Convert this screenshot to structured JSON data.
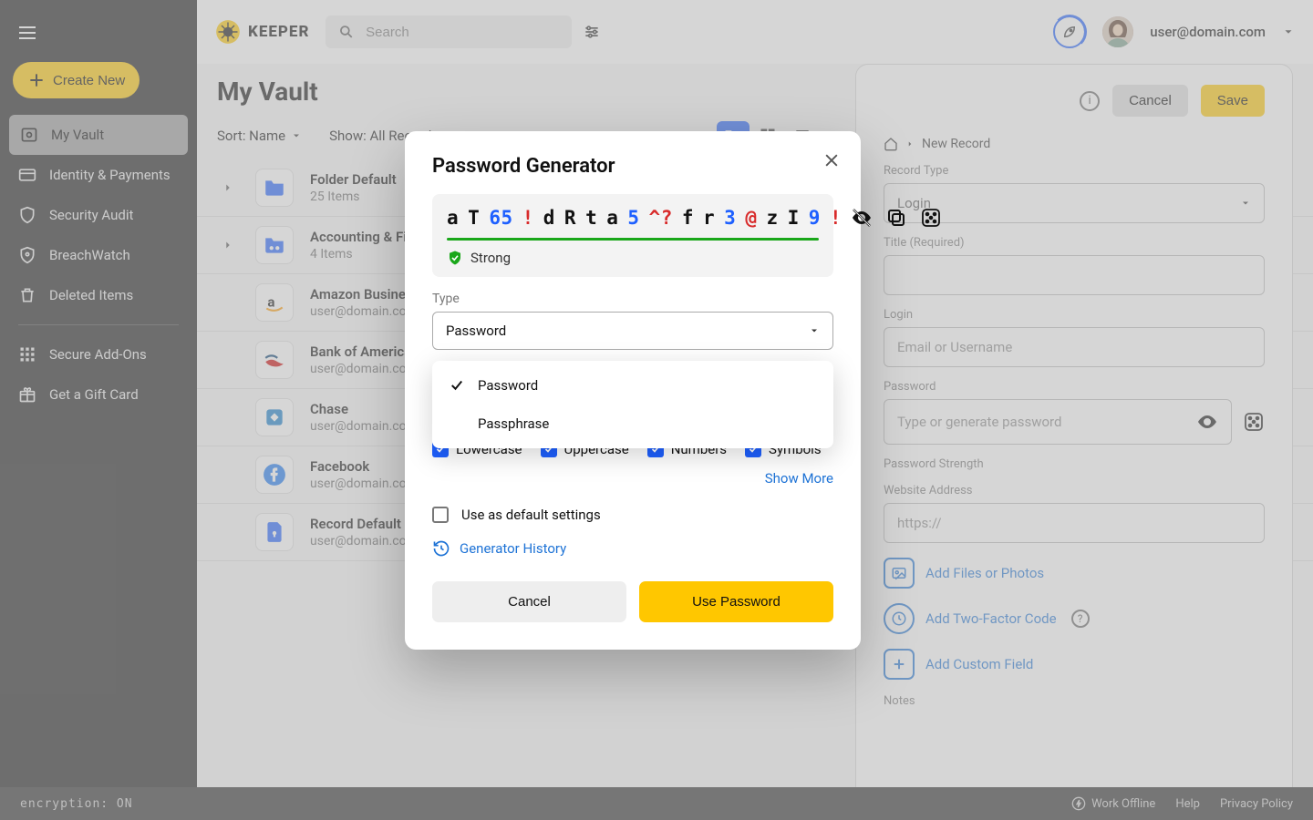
{
  "brand": "KEEPER",
  "search": {
    "placeholder": "Search"
  },
  "user": {
    "email": "user@domain.com"
  },
  "sidebar": {
    "create": "Create New",
    "items": [
      {
        "label": "My Vault"
      },
      {
        "label": "Identity & Payments"
      },
      {
        "label": "Security Audit"
      },
      {
        "label": "BreachWatch"
      },
      {
        "label": "Deleted Items"
      }
    ],
    "extras": [
      {
        "label": "Secure Add-Ons"
      },
      {
        "label": "Get a Gift Card"
      }
    ]
  },
  "page": {
    "title": "My Vault",
    "sort": "Sort: Name",
    "show": "Show: All Records"
  },
  "records": [
    {
      "title": "Folder Default",
      "sub": "25 Items",
      "folder": true
    },
    {
      "title": "Accounting & Finance",
      "sub": "4 Items",
      "folder": true,
      "shared": true
    },
    {
      "title": "Amazon Business",
      "sub": "user@domain.com"
    },
    {
      "title": "Bank of America",
      "sub": "user@domain.com"
    },
    {
      "title": "Chase",
      "sub": "user@domain.com"
    },
    {
      "title": "Facebook",
      "sub": "user@domain.com"
    },
    {
      "title": "Record Default",
      "sub": "user@domain.com"
    }
  ],
  "detail": {
    "cancel": "Cancel",
    "save": "Save",
    "breadcrumb": "New Record",
    "record_type_label": "Record Type",
    "record_type_value": "Login",
    "title_label": "Title (Required)",
    "login_label": "Login",
    "login_placeholder": "Email or Username",
    "password_label": "Password",
    "password_placeholder": "Type or generate password",
    "strength_label": "Password Strength",
    "website_label": "Website Address",
    "website_value": "https://",
    "add_files": "Add Files or Photos",
    "add_2fa": "Add Two-Factor Code",
    "add_custom": "Add Custom Field",
    "notes_label": "Notes"
  },
  "modal": {
    "title": "Password Generator",
    "password_segments": [
      {
        "t": "a",
        "c": "lower"
      },
      {
        "t": "T",
        "c": "upper"
      },
      {
        "t": "65",
        "c": "num"
      },
      {
        "t": "!",
        "c": "sym"
      },
      {
        "t": "d",
        "c": "lower"
      },
      {
        "t": "R",
        "c": "upper"
      },
      {
        "t": "t",
        "c": "lower"
      },
      {
        "t": "a",
        "c": "lower"
      },
      {
        "t": "5",
        "c": "num"
      },
      {
        "t": "^?",
        "c": "sym"
      },
      {
        "t": "f",
        "c": "lower"
      },
      {
        "t": "r",
        "c": "lower"
      },
      {
        "t": "3",
        "c": "num"
      },
      {
        "t": "@",
        "c": "sym"
      },
      {
        "t": "z",
        "c": "lower"
      },
      {
        "t": "I",
        "c": "upper"
      },
      {
        "t": "9",
        "c": "num"
      },
      {
        "t": "!",
        "c": "sym"
      }
    ],
    "strength": "Strong",
    "type_label": "Type",
    "type_value": "Password",
    "type_options": [
      "Password",
      "Passphrase"
    ],
    "type_selected_index": 0,
    "checks": {
      "lower": "Lowercase",
      "upper": "Uppercase",
      "numbers": "Numbers",
      "symbols": "Symbols"
    },
    "show_more": "Show More",
    "default_label": "Use as default settings",
    "history": "Generator History",
    "cancel": "Cancel",
    "use": "Use Password"
  },
  "status": {
    "encryption": "encryption: ON",
    "offline": "Work Offline",
    "help": "Help",
    "privacy": "Privacy Policy"
  }
}
